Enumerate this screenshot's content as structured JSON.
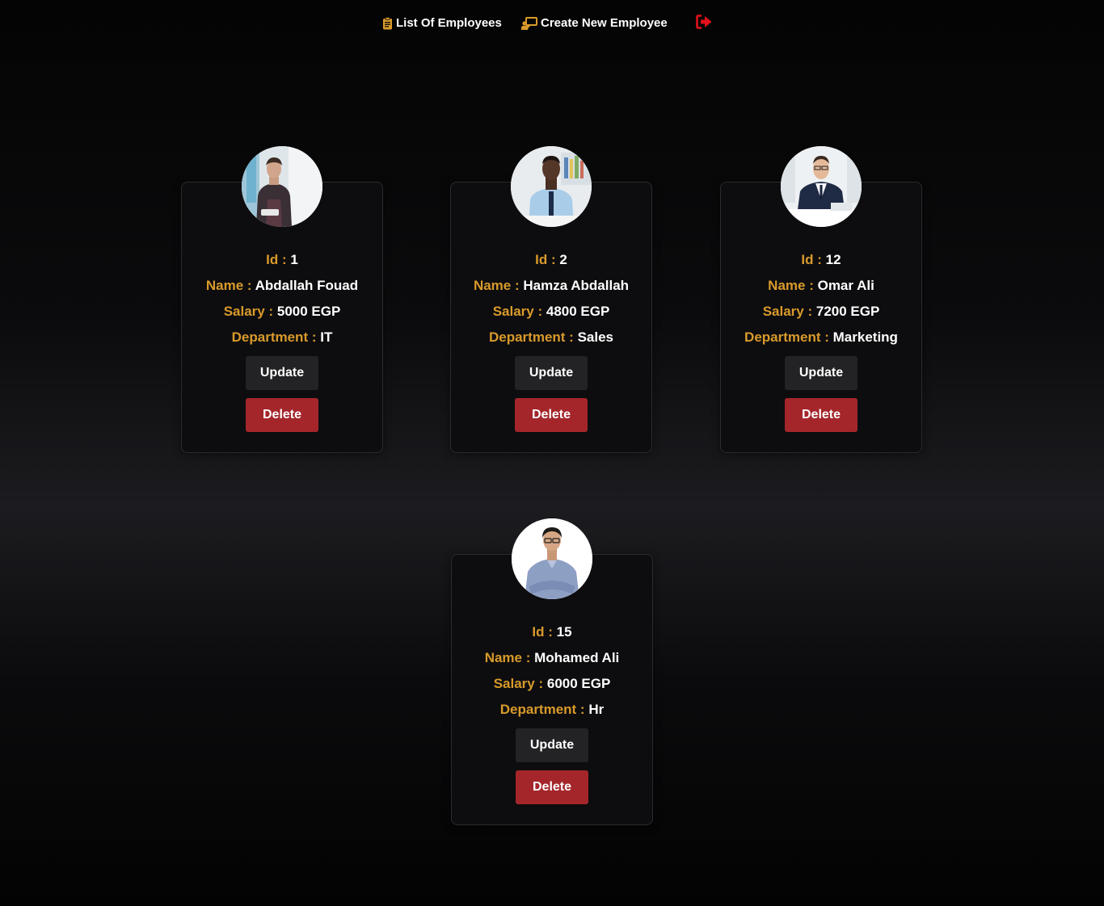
{
  "nav": {
    "list_label": "List Of Employees",
    "create_label": "Create New Employee"
  },
  "labels": {
    "id": "Id :",
    "name": "Name :",
    "salary": "Salary :",
    "department": "Department :",
    "update": "Update",
    "delete": "Delete"
  },
  "employees": [
    {
      "id": "1",
      "name": "Abdallah Fouad",
      "salary": "5000 EGP",
      "department": "IT"
    },
    {
      "id": "2",
      "name": "Hamza Abdallah",
      "salary": "4800 EGP",
      "department": "Sales"
    },
    {
      "id": "12",
      "name": "Omar Ali",
      "salary": "7200 EGP",
      "department": "Marketing"
    },
    {
      "id": "15",
      "name": "Mohamed Ali",
      "salary": "6000 EGP",
      "department": "Hr"
    }
  ],
  "colors": {
    "accent": "#d99a2b",
    "delete": "#a4262b",
    "update": "#232325",
    "logout": "#e3111b"
  }
}
